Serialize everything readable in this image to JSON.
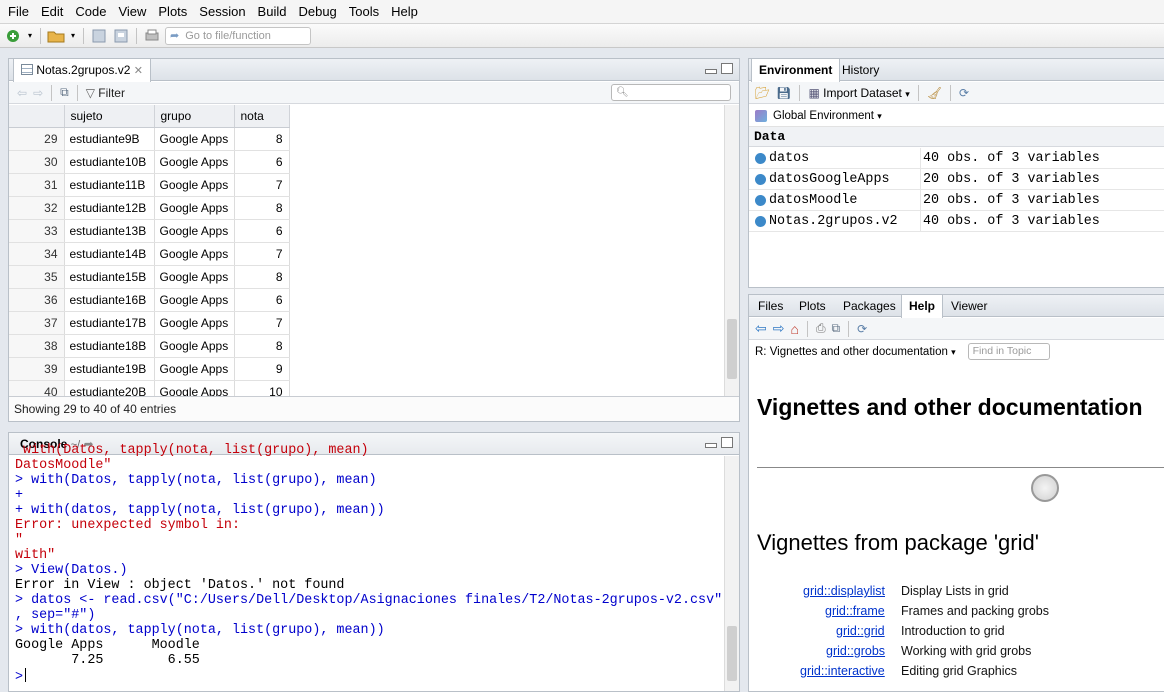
{
  "menu": [
    "File",
    "Edit",
    "Code",
    "View",
    "Plots",
    "Session",
    "Build",
    "Debug",
    "Tools",
    "Help"
  ],
  "toolbar": {
    "goto_placeholder": "Go to file/function"
  },
  "viewer": {
    "tab_label": "Notas.2grupos.v2",
    "filter_label": "Filter",
    "columns": [
      "sujeto",
      "grupo",
      "nota"
    ],
    "rows": [
      {
        "n": "29",
        "sujeto": "estudiante9B",
        "grupo": "Google Apps",
        "nota": "8"
      },
      {
        "n": "30",
        "sujeto": "estudiante10B",
        "grupo": "Google Apps",
        "nota": "6"
      },
      {
        "n": "31",
        "sujeto": "estudiante11B",
        "grupo": "Google Apps",
        "nota": "7"
      },
      {
        "n": "32",
        "sujeto": "estudiante12B",
        "grupo": "Google Apps",
        "nota": "8"
      },
      {
        "n": "33",
        "sujeto": "estudiante13B",
        "grupo": "Google Apps",
        "nota": "6"
      },
      {
        "n": "34",
        "sujeto": "estudiante14B",
        "grupo": "Google Apps",
        "nota": "7"
      },
      {
        "n": "35",
        "sujeto": "estudiante15B",
        "grupo": "Google Apps",
        "nota": "8"
      },
      {
        "n": "36",
        "sujeto": "estudiante16B",
        "grupo": "Google Apps",
        "nota": "6"
      },
      {
        "n": "37",
        "sujeto": "estudiante17B",
        "grupo": "Google Apps",
        "nota": "7"
      },
      {
        "n": "38",
        "sujeto": "estudiante18B",
        "grupo": "Google Apps",
        "nota": "8"
      },
      {
        "n": "39",
        "sujeto": "estudiante19B",
        "grupo": "Google Apps",
        "nota": "9"
      },
      {
        "n": "40",
        "sujeto": "estudiante20B",
        "grupo": "Google Apps",
        "nota": "10"
      }
    ],
    "status": "Showing 29 to 40 of 40 entries"
  },
  "console": {
    "tab_label": "Console",
    "path": "~/",
    "lines": [
      {
        "kind": "err",
        "text": " with(Datos, tapply(nota, list(grupo), mean)"
      },
      {
        "kind": "err",
        "text": "DatosMoodle\""
      },
      {
        "kind": "in",
        "text": "> with(Datos, tapply(nota, list(grupo), mean)"
      },
      {
        "kind": "in",
        "text": "+"
      },
      {
        "kind": "in",
        "text": "+ with(datos, tapply(nota, list(grupo), mean))"
      },
      {
        "kind": "err",
        "text": "Error: unexpected symbol in:"
      },
      {
        "kind": "err",
        "text": "\""
      },
      {
        "kind": "err",
        "text": "with\""
      },
      {
        "kind": "in",
        "text": "> View(Datos.)"
      },
      {
        "kind": "out",
        "text": "Error in View : object 'Datos.' not found"
      },
      {
        "kind": "in",
        "text": "> datos <- read.csv(\"C:/Users/Dell/Desktop/Asignaciones finales/T2/Notas-2grupos-v2.csv\""
      },
      {
        "kind": "in",
        "text": ", sep=\"#\")"
      },
      {
        "kind": "in",
        "text": "> with(datos, tapply(nota, list(grupo), mean))"
      },
      {
        "kind": "out",
        "text": "Google Apps      Moodle "
      },
      {
        "kind": "out",
        "text": "       7.25        6.55 "
      }
    ],
    "prompt": ">"
  },
  "environment": {
    "tabs": [
      "Environment",
      "History"
    ],
    "import_label": "Import Dataset",
    "scope_label": "Global Environment",
    "section": "Data",
    "items": [
      {
        "name": "datos",
        "value": "40 obs. of 3 variables"
      },
      {
        "name": "datosGoogleApps",
        "value": "20 obs. of 3 variables"
      },
      {
        "name": "datosMoodle",
        "value": "20 obs. of 3 variables"
      },
      {
        "name": "Notas.2grupos.v2",
        "value": "40 obs. of 3 variables"
      }
    ]
  },
  "help": {
    "tabs": [
      "Files",
      "Plots",
      "Packages",
      "Help",
      "Viewer"
    ],
    "topic_label": "R: Vignettes and other documentation",
    "find_placeholder": "Find in Topic",
    "title": "Vignettes and other documentation",
    "subtitle": "Vignettes from package 'grid'",
    "vignettes": [
      {
        "link": "grid::displaylist",
        "desc": "Display Lists in grid"
      },
      {
        "link": "grid::frame",
        "desc": "Frames and packing grobs"
      },
      {
        "link": "grid::grid",
        "desc": "Introduction to grid"
      },
      {
        "link": "grid::grobs",
        "desc": "Working with grid grobs"
      },
      {
        "link": "grid::interactive",
        "desc": "Editing grid Graphics"
      }
    ]
  }
}
